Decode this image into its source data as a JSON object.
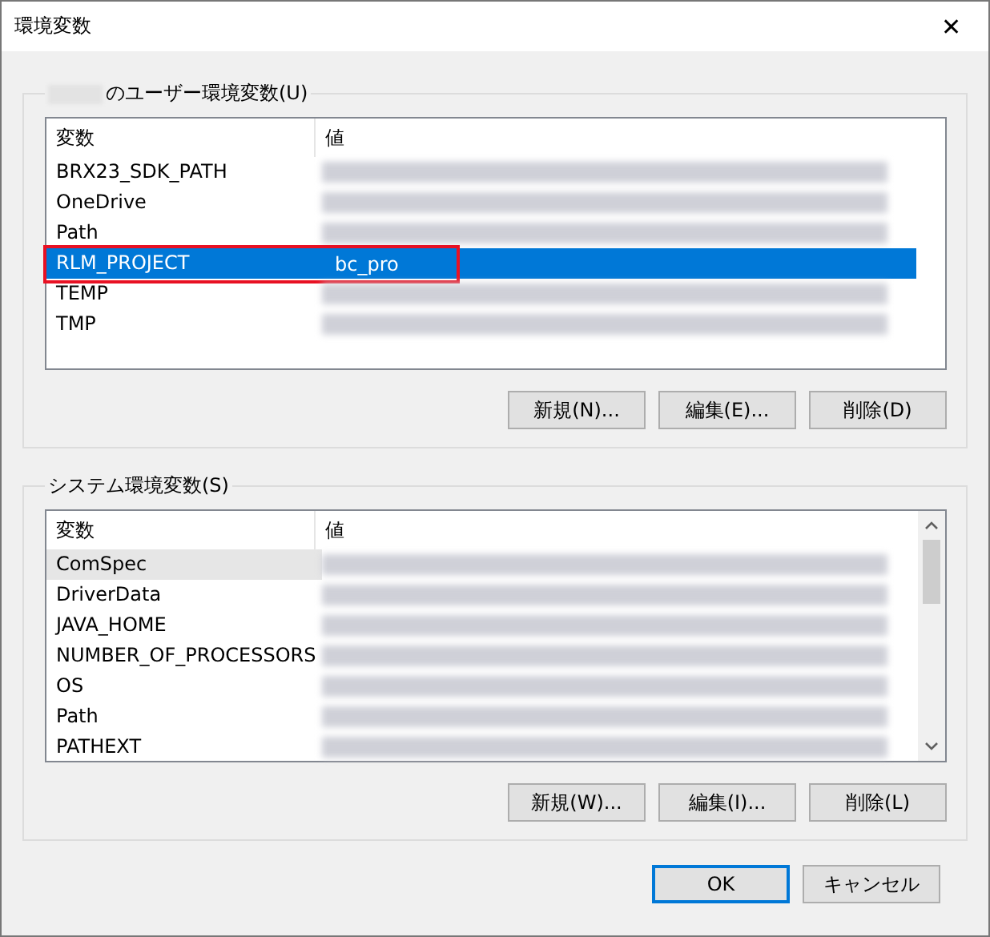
{
  "window": {
    "title": "環境変数",
    "close": "✕"
  },
  "user_group": {
    "owner_redacted": true,
    "label": "のユーザー環境変数(U)",
    "columns": [
      "変数",
      "値"
    ],
    "focused": true,
    "rows": [
      {
        "name": "BRX23_SDK_PATH",
        "selected": false,
        "highlighted": false
      },
      {
        "name": "OneDrive",
        "selected": false,
        "highlighted": false
      },
      {
        "name": "Path",
        "selected": false,
        "highlighted": false
      },
      {
        "name": "RLM_PROJECT",
        "value": "bc_pro",
        "selected": true,
        "highlighted": true
      },
      {
        "name": "TEMP",
        "selected": false,
        "highlighted": false
      },
      {
        "name": "TMP",
        "selected": false,
        "highlighted": false
      }
    ],
    "buttons": [
      "新規(N)...",
      "編集(E)...",
      "削除(D)"
    ]
  },
  "system_group": {
    "label": "システム環境変数(S)",
    "columns": [
      "変数",
      "値"
    ],
    "focused": false,
    "rows": [
      {
        "name": "ComSpec",
        "selected": true,
        "highlighted": false
      },
      {
        "name": "DriverData",
        "selected": false,
        "highlighted": false
      },
      {
        "name": "JAVA_HOME",
        "selected": false,
        "highlighted": false
      },
      {
        "name": "NUMBER_OF_PROCESSORS",
        "selected": false,
        "highlighted": false
      },
      {
        "name": "OS",
        "selected": false,
        "highlighted": false
      },
      {
        "name": "Path",
        "selected": false,
        "highlighted": false
      },
      {
        "name": "PATHEXT",
        "selected": false,
        "highlighted": false
      }
    ],
    "buttons": [
      "新規(W)...",
      "編集(I)...",
      "削除(L)"
    ]
  },
  "footer_buttons": [
    {
      "label": "OK",
      "default": true
    },
    {
      "label": "キャンセル",
      "default": false
    }
  ]
}
